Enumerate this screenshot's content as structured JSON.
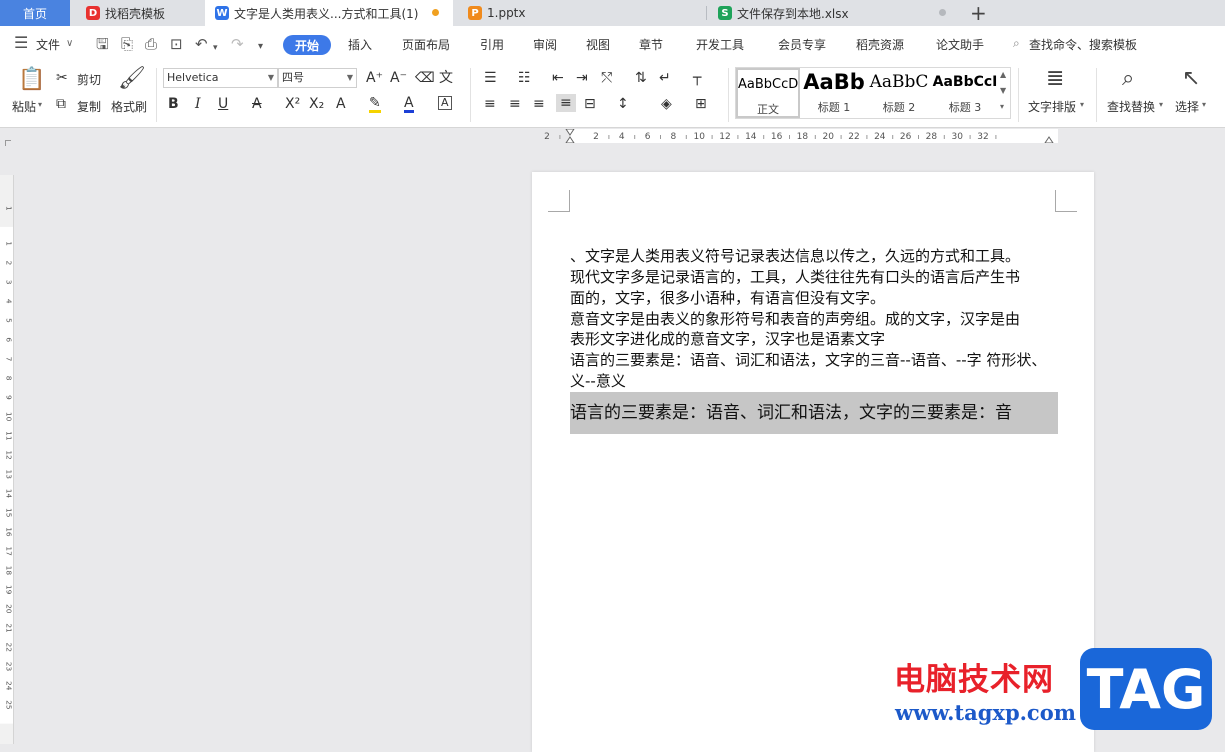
{
  "tabs": [
    {
      "label": "首页"
    },
    {
      "label": "找稻壳模板",
      "icon": "daoke-icon",
      "color": "#e8312f",
      "glyph": "D"
    },
    {
      "label": "文字是人类用表义...方式和工具(1)",
      "icon": "writer-icon",
      "color": "#2f73e8",
      "glyph": "W"
    },
    {
      "label": "1.pptx",
      "icon": "presentation-icon",
      "color": "#f08a1c",
      "glyph": "P"
    },
    {
      "label": "文件保存到本地.xlsx",
      "icon": "spreadsheet-icon",
      "color": "#1fa35a",
      "glyph": "S"
    }
  ],
  "new_tab": "+",
  "menu": {
    "file": "文件",
    "items": [
      "开始",
      "插入",
      "页面布局",
      "引用",
      "审阅",
      "视图",
      "章节",
      "开发工具",
      "会员专享",
      "稻壳资源",
      "论文助手"
    ],
    "search": "查找命令、搜索模板"
  },
  "ribbon": {
    "paste": "粘贴",
    "cut": "剪切",
    "copy": "复制",
    "format_painter": "格式刷",
    "font_name": "Helvetica",
    "font_size": "四号",
    "styles": [
      {
        "sample": "AaBbCcD",
        "name": "正文"
      },
      {
        "sample": "AaBb",
        "name": "标题 1"
      },
      {
        "sample": "AaBbC",
        "name": "标题 2"
      },
      {
        "sample": "AaBbCcI",
        "name": "标题 3"
      }
    ],
    "text_layout": "文字排版",
    "find_replace": "查找替换",
    "select": "选择"
  },
  "ruler_h": [
    "2",
    "2",
    "4",
    "6",
    "8",
    "10",
    "12",
    "14",
    "16",
    "18",
    "20",
    "22",
    "24",
    "26",
    "28",
    "30",
    "32"
  ],
  "ruler_v": [
    "1",
    "1",
    "2",
    "3",
    "4",
    "5",
    "6",
    "7",
    "8",
    "9",
    "10",
    "11",
    "12",
    "13",
    "14",
    "15",
    "16",
    "17",
    "18",
    "19",
    "20",
    "21",
    "22",
    "23",
    "24",
    "25"
  ],
  "document": {
    "lines": [
      "、文字是人类用表义符号记录表达信息以传之，久远的方式和工具。",
      "现代文字多是记录语言的，工具，人类往往先有口头的语言后产生书",
      "面的，文字，很多小语种，有语言但没有文字。",
      "意音文字是由表义的象形符号和表音的声旁组。成的文字，汉字是由",
      "表形文字进化成的意音文字，汉字也是语素文字",
      "语言的三要素是：语音、词汇和语法，文字的三音--语音、--字  符形状、",
      "义--意义"
    ],
    "selected": "语言的三要素是：语音、词汇和语法，文字的三要素是：音"
  },
  "watermark": {
    "title": "电脑技术网",
    "url": "www.tagxp.com",
    "logo": "TAG"
  }
}
